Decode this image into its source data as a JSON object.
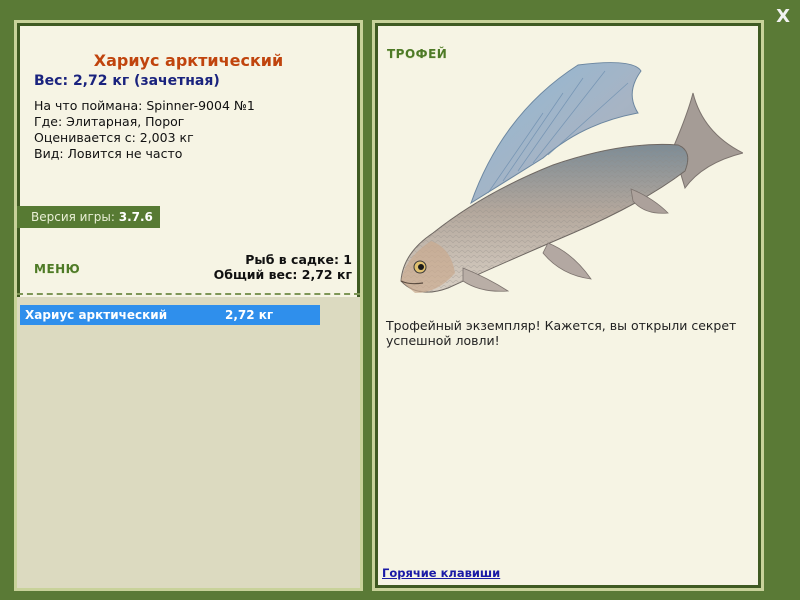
{
  "close_label": "X",
  "fish": {
    "title": "Хариус арктический",
    "weight_line": "Вес: 2,72 кг (зачетная)",
    "caught_with": "На что поймана: Spinner-9004 №1",
    "location": "Где: Элитарная, Порог",
    "rated_from": "Оценивается с: 2,003 кг",
    "species_rarity": "Вид: Ловится не часто"
  },
  "version": {
    "label": "Версия игры:",
    "value": "3.7.6"
  },
  "menu_label": "МЕНЮ",
  "keepnet": {
    "count_line": "Рыб в садке: 1",
    "total_line": "Общий вес: 2,72 кг"
  },
  "catch_list": [
    {
      "name": "Хариус арктический",
      "weight": "2,72 кг"
    }
  ],
  "trophy": {
    "label": "ТРОФЕЙ",
    "description": "Трофейный экземпляр! Кажется, вы открыли секрет успешной ловли!",
    "image_icon": "arctic-grayling-fish"
  },
  "hotkeys_label": "Горячие клавиши",
  "colors": {
    "background": "#5a7a36",
    "panel": "#f6f4e4",
    "title": "#c0440d",
    "weight": "#1a237e",
    "selection": "#2f8fec",
    "accent_green": "#4e7a26"
  }
}
